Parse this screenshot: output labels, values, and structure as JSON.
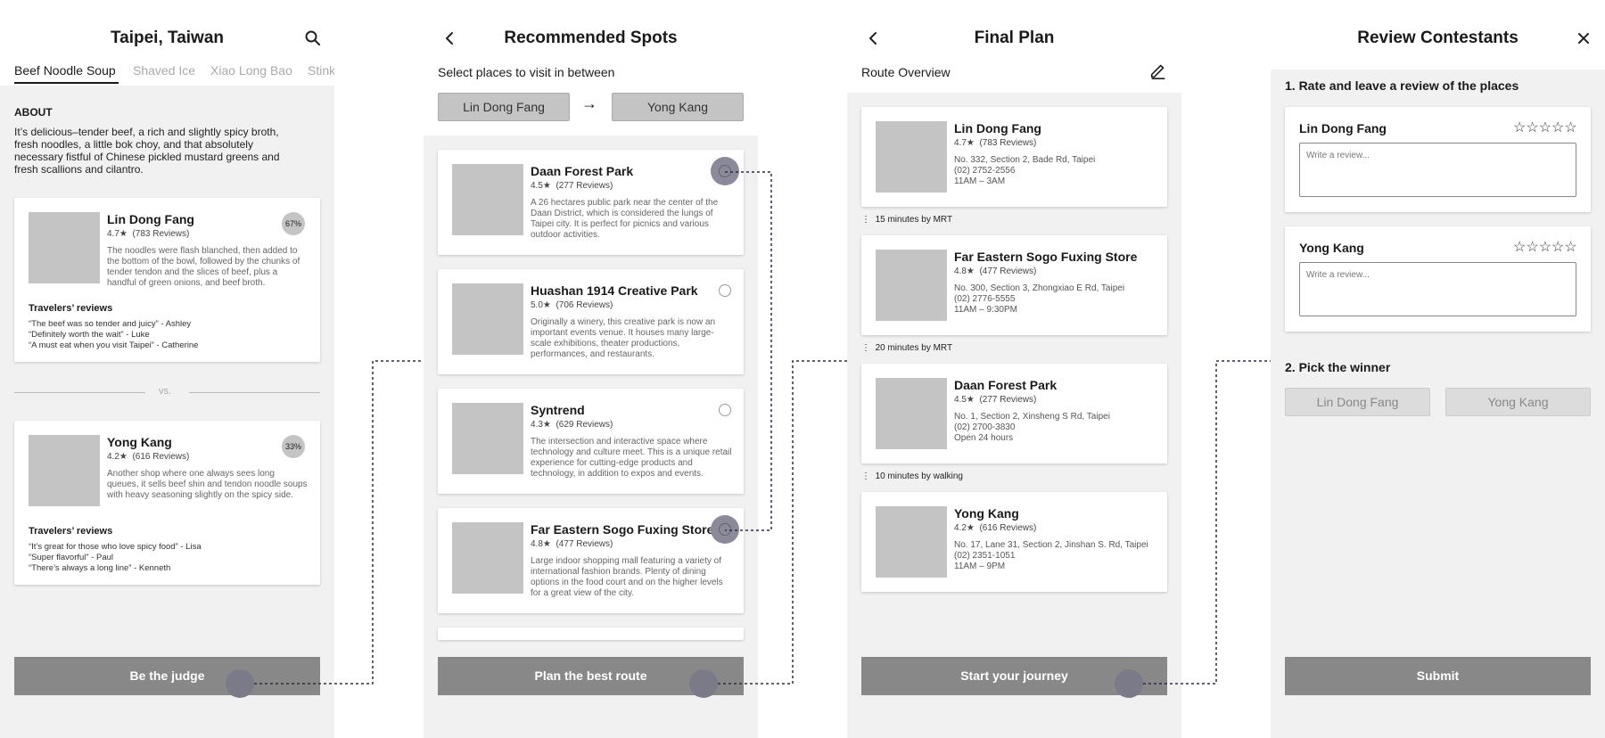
{
  "screen1": {
    "title": "Taipei, Taiwan",
    "tabs": [
      {
        "label": "Beef Noodle Soup",
        "active": true
      },
      {
        "label": "Shaved Ice",
        "active": false
      },
      {
        "label": "Xiao Long Bao",
        "active": false
      },
      {
        "label": "Stink",
        "active": false
      }
    ],
    "about_heading": "ABOUT",
    "about_text": "It’s delicious–tender beef, a rich and slightly spicy broth, fresh noodles, a little bok choy, and that absolutely necessary fistful of Chinese pickled mustard greens and fresh scallions and cilantro.",
    "contestants": [
      {
        "name": "Lin Dong Fang",
        "rating": "4.7",
        "reviews": "(783 Reviews)",
        "percent": "67%",
        "description": "The noodles were flash blanched, then added to the bottom of the bowl, followed by the chunks of tender tendon and the slices of beef, plus a handful of green onions, and beef broth.",
        "reviews_heading": "Travelers’ reviews",
        "quotes": [
          "“The beef was so tender and juicy” - Ashley",
          "“Definitely worth the wait” - Luke",
          "“A must eat when you visit Taipei” - Catherine"
        ]
      },
      {
        "name": "Yong Kang",
        "rating": "4.2",
        "reviews": "(616 Reviews)",
        "percent": "33%",
        "description": "Another shop where one always sees long queues, it sells beef shin and tendon noodle soups with heavy seasoning slightly on the spicy side.",
        "reviews_heading": "Travelers’ reviews",
        "quotes": [
          "“It’s great for those who love spicy food” - Lisa",
          "“Super flavorful” - Paul",
          "“There’s always a long line” - Kenneth"
        ]
      }
    ],
    "vs_label": "vs.",
    "button_label": "Be the judge"
  },
  "screen2": {
    "title": "Recommended Spots",
    "subtitle": "Select places to visit in between",
    "from": "Lin Dong Fang",
    "arrow": "→",
    "to": "Yong Kang",
    "spots": [
      {
        "name": "Daan Forest Park",
        "rating": "4.5",
        "reviews": "(277 Reviews)",
        "description": "A 26 hectares public park near the center of the Daan District, which is considered the lungs of Taipei city. It is perfect for picnics and various outdoor activities.",
        "selected": true
      },
      {
        "name": "Huashan 1914 Creative Park",
        "rating": "5.0",
        "reviews": "(706 Reviews)",
        "description": "Originally a winery, this creative park is now an important events venue. It houses many large-scale exhibitions, theater productions, performances, and restaurants.",
        "selected": false
      },
      {
        "name": "Syntrend",
        "rating": "4.3",
        "reviews": "(629 Reviews)",
        "description": "The intersection and interactive space where technology and culture meet. This is a unique retail experience for cutting-edge products and technology, in addition to expos and events.",
        "selected": false
      },
      {
        "name": "Far Eastern Sogo Fuxing Store",
        "rating": "4.8",
        "reviews": "(477 Reviews)",
        "description": "Large indoor shopping mall featuring a variety of international fashion brands. Plenty of dining options in the food court and on the higher levels for a great view of the city.",
        "selected": true
      }
    ],
    "button_label": "Plan the best route"
  },
  "screen3": {
    "title": "Final Plan",
    "subtitle": "Route Overview",
    "stops": [
      {
        "name": "Lin Dong Fang",
        "rating": "4.7",
        "reviews": "(783 Reviews)",
        "address": "No. 332, Section 2, Bade Rd, Taipei",
        "phone": "(02) 2752-2556",
        "hours": "11AM – 3AM"
      },
      {
        "name": "Far Eastern Sogo Fuxing Store",
        "rating": "4.8",
        "reviews": "(477 Reviews)",
        "address": "No. 300, Section 3, Zhongxiao E Rd, Taipei",
        "phone": "(02) 2776-5555",
        "hours": "11AM – 9:30PM"
      },
      {
        "name": "Daan Forest Park",
        "rating": "4.5",
        "reviews": "(277 Reviews)",
        "address": "No. 1, Section 2, Xinsheng S Rd, Taipei",
        "phone": "(02) 2700-3830",
        "hours": "Open 24 hours"
      },
      {
        "name": "Yong Kang",
        "rating": "4.2",
        "reviews": "(616 Reviews)",
        "address": "No. 17, Lane 31, Section 2, Jinshan S. Rd, Taipei",
        "phone": "(02) 2351-1051",
        "hours": "11AM – 9PM"
      }
    ],
    "legs": [
      "15 minutes by MRT",
      "20 minutes by MRT",
      "10 minutes by walking"
    ],
    "button_label": "Start your journey"
  },
  "screen4": {
    "title": "Review Contestants",
    "step1": "1. Rate and leave a review of the places",
    "places": [
      {
        "name": "Lin Dong Fang",
        "stars": "☆☆☆☆☆",
        "placeholder": "Write a review..."
      },
      {
        "name": "Yong Kang",
        "stars": "☆☆☆☆☆",
        "placeholder": "Write a review..."
      }
    ],
    "step2": "2. Pick the winner",
    "choices": [
      "Lin Dong Fang",
      "Yong Kang"
    ],
    "button_label": "Submit"
  },
  "icons": {
    "search": "search-icon",
    "back": "chevron-left-icon",
    "edit": "pencil-icon",
    "close": "close-icon",
    "star": "★"
  },
  "colors": {
    "panel_gray": "#f1f1f1",
    "thumb_gray": "#c4c4c4",
    "button_gray": "#888888",
    "connector": "#2b2b4a"
  }
}
